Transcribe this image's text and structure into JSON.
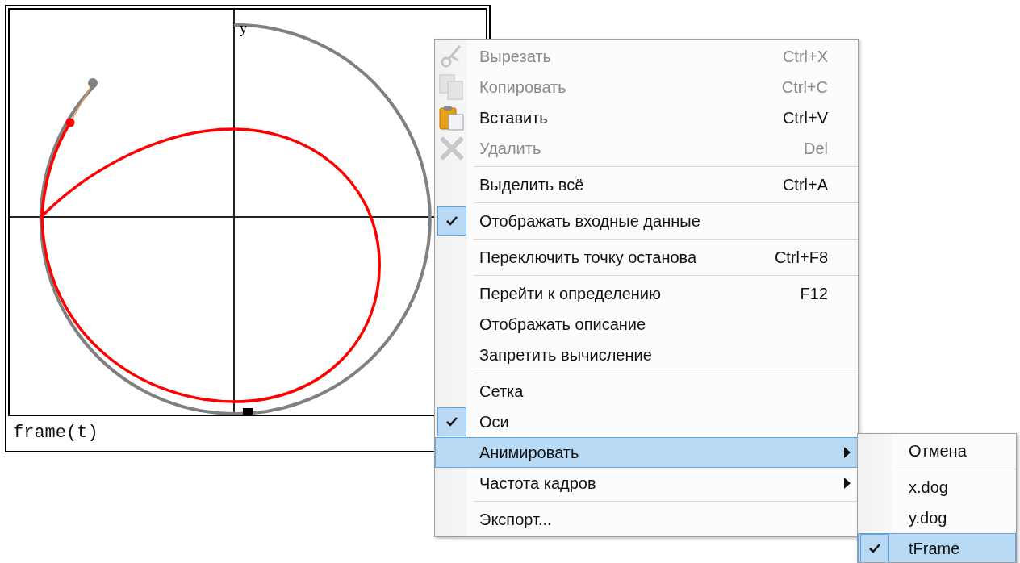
{
  "plot": {
    "axis_label": "y",
    "caption": "frame(t)"
  },
  "context_menu": {
    "items": [
      {
        "kind": "item",
        "label": "Вырезать",
        "shortcut": "Ctrl+X",
        "disabled": true,
        "checked": false,
        "selected": false,
        "submenu": false
      },
      {
        "kind": "item",
        "label": "Копировать",
        "shortcut": "Ctrl+C",
        "disabled": true,
        "checked": false,
        "selected": false,
        "submenu": false
      },
      {
        "kind": "item",
        "label": "Вставить",
        "shortcut": "Ctrl+V",
        "disabled": false,
        "checked": false,
        "selected": false,
        "submenu": false
      },
      {
        "kind": "item",
        "label": "Удалить",
        "shortcut": "Del",
        "disabled": true,
        "checked": false,
        "selected": false,
        "submenu": false
      },
      {
        "kind": "separator"
      },
      {
        "kind": "item",
        "label": "Выделить всё",
        "shortcut": "Ctrl+A",
        "disabled": false,
        "checked": false,
        "selected": false,
        "submenu": false
      },
      {
        "kind": "separator"
      },
      {
        "kind": "item",
        "label": "Отображать входные данные",
        "disabled": false,
        "checked": true,
        "selected": false,
        "submenu": false
      },
      {
        "kind": "separator"
      },
      {
        "kind": "item",
        "label": "Переключить точку останова",
        "shortcut": "Ctrl+F8",
        "disabled": false,
        "checked": false,
        "selected": false,
        "submenu": false
      },
      {
        "kind": "separator"
      },
      {
        "kind": "item",
        "label": "Перейти к определению",
        "shortcut": "F12",
        "disabled": false,
        "checked": false,
        "selected": false,
        "submenu": false
      },
      {
        "kind": "item",
        "label": "Отображать описание",
        "disabled": false,
        "checked": false,
        "selected": false,
        "submenu": false
      },
      {
        "kind": "item",
        "label": "Запретить вычисление",
        "disabled": false,
        "checked": false,
        "selected": false,
        "submenu": false
      },
      {
        "kind": "separator"
      },
      {
        "kind": "item",
        "label": "Сетка",
        "disabled": false,
        "checked": false,
        "selected": false,
        "submenu": false
      },
      {
        "kind": "item",
        "label": "Оси",
        "disabled": false,
        "checked": true,
        "selected": false,
        "submenu": false
      },
      {
        "kind": "item",
        "label": "Анимировать",
        "disabled": false,
        "checked": false,
        "selected": true,
        "submenu": true
      },
      {
        "kind": "item",
        "label": "Частота кадров",
        "disabled": false,
        "checked": false,
        "selected": false,
        "submenu": true
      },
      {
        "kind": "separator"
      },
      {
        "kind": "item",
        "label": "Экспорт...",
        "disabled": false,
        "checked": false,
        "selected": false,
        "submenu": false
      }
    ]
  },
  "submenu": {
    "items": [
      {
        "kind": "item",
        "label": "Отмена",
        "checked": false,
        "selected": false
      },
      {
        "kind": "separator"
      },
      {
        "kind": "item",
        "label": "x.dog",
        "checked": false,
        "selected": false
      },
      {
        "kind": "item",
        "label": "y.dog",
        "checked": false,
        "selected": false
      },
      {
        "kind": "item",
        "label": "tFrame",
        "checked": true,
        "selected": true
      }
    ]
  }
}
